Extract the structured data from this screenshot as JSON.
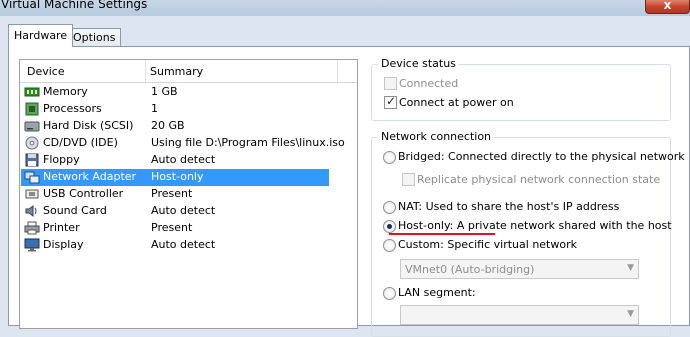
{
  "window": {
    "title": "Virtual Machine Settings",
    "close_glyph": "x"
  },
  "tabs": [
    {
      "label": "Hardware",
      "active": true
    },
    {
      "label": "Options",
      "active": false
    }
  ],
  "device_list": {
    "columns": [
      "Device",
      "Summary"
    ],
    "rows": [
      {
        "device": "Memory",
        "summary": "1 GB",
        "icon": "memory-icon"
      },
      {
        "device": "Processors",
        "summary": "1",
        "icon": "processor-icon"
      },
      {
        "device": "Hard Disk (SCSI)",
        "summary": "20 GB",
        "icon": "hard-disk-icon"
      },
      {
        "device": "CD/DVD (IDE)",
        "summary": "Using file D:\\Program Files\\linux.iso",
        "icon": "cd-dvd-icon"
      },
      {
        "device": "Floppy",
        "summary": "Auto detect",
        "icon": "floppy-icon"
      },
      {
        "device": "Network Adapter",
        "summary": "Host-only",
        "icon": "network-adapter-icon",
        "selected": true
      },
      {
        "device": "USB Controller",
        "summary": "Present",
        "icon": "usb-icon"
      },
      {
        "device": "Sound Card",
        "summary": "Auto detect",
        "icon": "sound-card-icon"
      },
      {
        "device": "Printer",
        "summary": "Present",
        "icon": "printer-icon"
      },
      {
        "device": "Display",
        "summary": "Auto detect",
        "icon": "display-icon"
      }
    ]
  },
  "device_status": {
    "title": "Device status",
    "connected": {
      "label": "Connected",
      "checked": false,
      "enabled": false
    },
    "connect_at_power_on": {
      "label": "Connect at power on",
      "checked": true,
      "enabled": true
    }
  },
  "network_connection": {
    "title": "Network connection",
    "bridged": {
      "label": "Bridged: Connected directly to the physical network",
      "selected": false
    },
    "replicate": {
      "label": "Replicate physical network connection state",
      "checked": false,
      "enabled": false
    },
    "nat": {
      "label": "NAT: Used to share the host's IP address",
      "selected": false
    },
    "host_only": {
      "label": "Host-only: A private network shared with the host",
      "selected": true
    },
    "custom": {
      "label": "Custom: Specific virtual network",
      "selected": false
    },
    "custom_select": {
      "value": "VMnet0 (Auto-bridging)",
      "enabled": false
    },
    "lan_segment": {
      "label": "LAN segment:",
      "selected": false
    },
    "lan_select": {
      "value": "",
      "enabled": false
    }
  },
  "colors": {
    "selection": "#3399ff",
    "annotation": "#e0141b"
  }
}
